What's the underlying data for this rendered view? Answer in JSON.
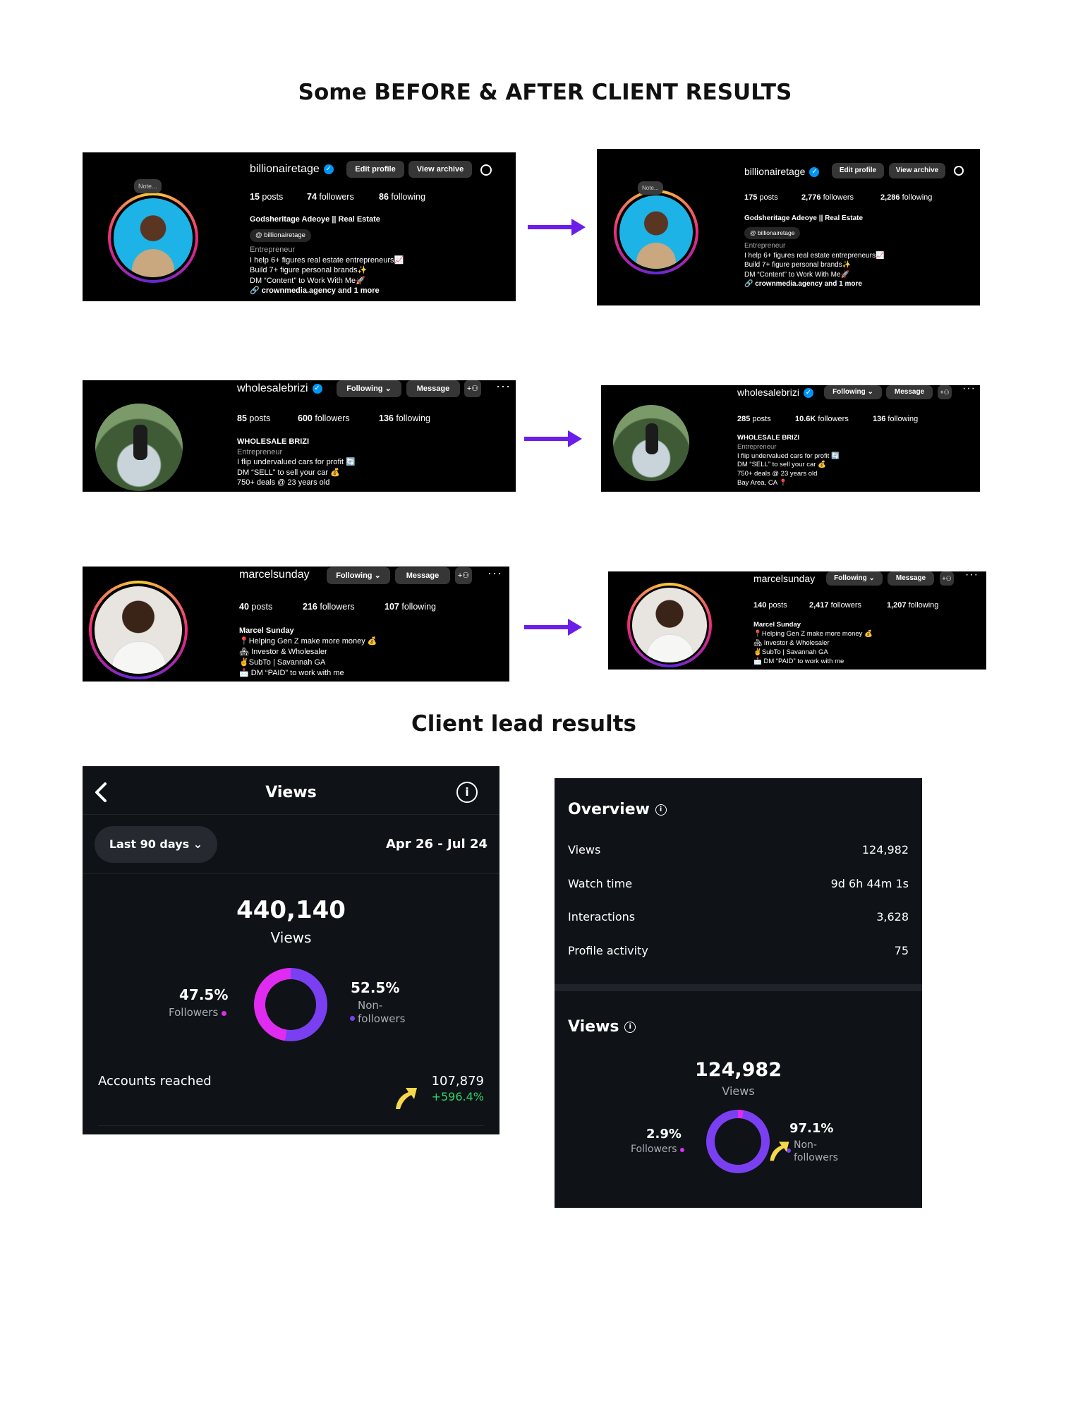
{
  "headings": {
    "before_after": "Some BEFORE & AFTER CLIENT RESULTS",
    "leads": "Client lead results"
  },
  "profiles": {
    "billionaire_before": {
      "username": "billionairetage",
      "edit_btn": "Edit profile",
      "archive_btn": "View archive",
      "note": "Note...",
      "posts": "15",
      "posts_label": "posts",
      "followers": "74",
      "followers_label": "followers",
      "following": "86",
      "following_label": "following",
      "name": "Godsheritage Adeoye || Real Estate",
      "threads": "billionairetage",
      "category": "Entrepreneur",
      "bio1": "I help 6+ figures real estate entrepreneurs📈",
      "bio2": "Build 7+ figure personal brands✨",
      "bio3": "DM “Content” to Work With Me🚀",
      "link": "crownmedia.agency and 1 more"
    },
    "billionaire_after": {
      "username": "billionairetage",
      "edit_btn": "Edit profile",
      "archive_btn": "View archive",
      "note": "Note...",
      "posts": "175",
      "posts_label": "posts",
      "followers": "2,776",
      "followers_label": "followers",
      "following": "2,286",
      "following_label": "following",
      "name": "Godsheritage Adeoye || Real Estate",
      "threads": "billionairetage",
      "category": "Entrepreneur",
      "bio1": "I help 6+ figures real estate entrepreneurs📈",
      "bio2": "Build 7+ figure personal brands✨",
      "bio3": "DM “Content” to Work With Me🚀",
      "link": "crownmedia.agency and 1 more"
    },
    "brizi_before": {
      "username": "wholesalebrizi",
      "following_btn": "Following",
      "message_btn": "Message",
      "posts": "85",
      "posts_label": "posts",
      "followers": "600",
      "followers_label": "followers",
      "following": "136",
      "following_label": "following",
      "name": "WHOLESALE BRIZI",
      "category": "Entrepreneur",
      "bio1": "I flip undervalued cars for profit 🔄",
      "bio2": "DM “SELL” to sell your car 💰",
      "bio3": "750+ deals @ 23 years old"
    },
    "brizi_after": {
      "username": "wholesalebrizi",
      "following_btn": "Following",
      "message_btn": "Message",
      "posts": "285",
      "posts_label": "posts",
      "followers": "10.6K",
      "followers_label": "followers",
      "following": "136",
      "following_label": "following",
      "name": "WHOLESALE BRIZI",
      "category": "Entrepreneur",
      "bio1": "I flip undervalued cars for profit 🔄",
      "bio2": "DM “SELL” to sell your car 💰",
      "bio3": "750+ deals @ 23 years old",
      "bio4": "Bay Area, CA 📍"
    },
    "marcel_before": {
      "username": "marcelsunday",
      "following_btn": "Following",
      "message_btn": "Message",
      "posts": "40",
      "posts_label": "posts",
      "followers": "216",
      "followers_label": "followers",
      "following": "107",
      "following_label": "following",
      "name": "Marcel Sunday",
      "bio1": "📍Helping Gen Z make more money 💰",
      "bio2": "🏘 Investor & Wholesaler",
      "bio3": "✌SubTo | Savannah GA",
      "bio4": "📩 DM “PAID” to work with me"
    },
    "marcel_after": {
      "username": "marcelsunday",
      "following_btn": "Following",
      "message_btn": "Message",
      "posts": "140",
      "posts_label": "posts",
      "followers": "2,417",
      "followers_label": "followers",
      "following": "1,207",
      "following_label": "following",
      "name": "Marcel Sunday",
      "bio1": "📍Helping Gen Z make more money 💰",
      "bio2": "🏘 Investor & Wholesaler",
      "bio3": "✌SubTo | Savannah GA",
      "bio4": "📩 DM “PAID” to work with me"
    }
  },
  "views_panel": {
    "title": "Views",
    "range_btn": "Last 90 days",
    "date_range": "Apr 26 - Jul 24",
    "total": "440,140",
    "total_label": "Views",
    "followers_pct": "47.5%",
    "followers_label": "Followers",
    "followers_fraction": 0.475,
    "nonfollowers_pct": "52.5%",
    "nonfollowers_label1": "Non-",
    "nonfollowers_label2": "followers",
    "reached_label": "Accounts reached",
    "reached_value": "107,879",
    "reached_change": "+596.4%",
    "colors": {
      "followers": "#e02cf0",
      "nonfollowers": "#7b3ff2",
      "growth": "#2fd36a"
    }
  },
  "overview_panel": {
    "title": "Overview",
    "rows": [
      {
        "label": "Views",
        "value": "124,982"
      },
      {
        "label": "Watch time",
        "value": "9d 6h 44m 1s"
      },
      {
        "label": "Interactions",
        "value": "3,628"
      },
      {
        "label": "Profile activity",
        "value": "75"
      }
    ],
    "views_title": "Views",
    "total": "124,982",
    "total_label": "Views",
    "followers_pct": "2.9%",
    "followers_label": "Followers",
    "followers_fraction": 0.029,
    "nonfollowers_pct": "97.1%",
    "nonfollowers_label1": "Non-",
    "nonfollowers_label2": "followers"
  }
}
